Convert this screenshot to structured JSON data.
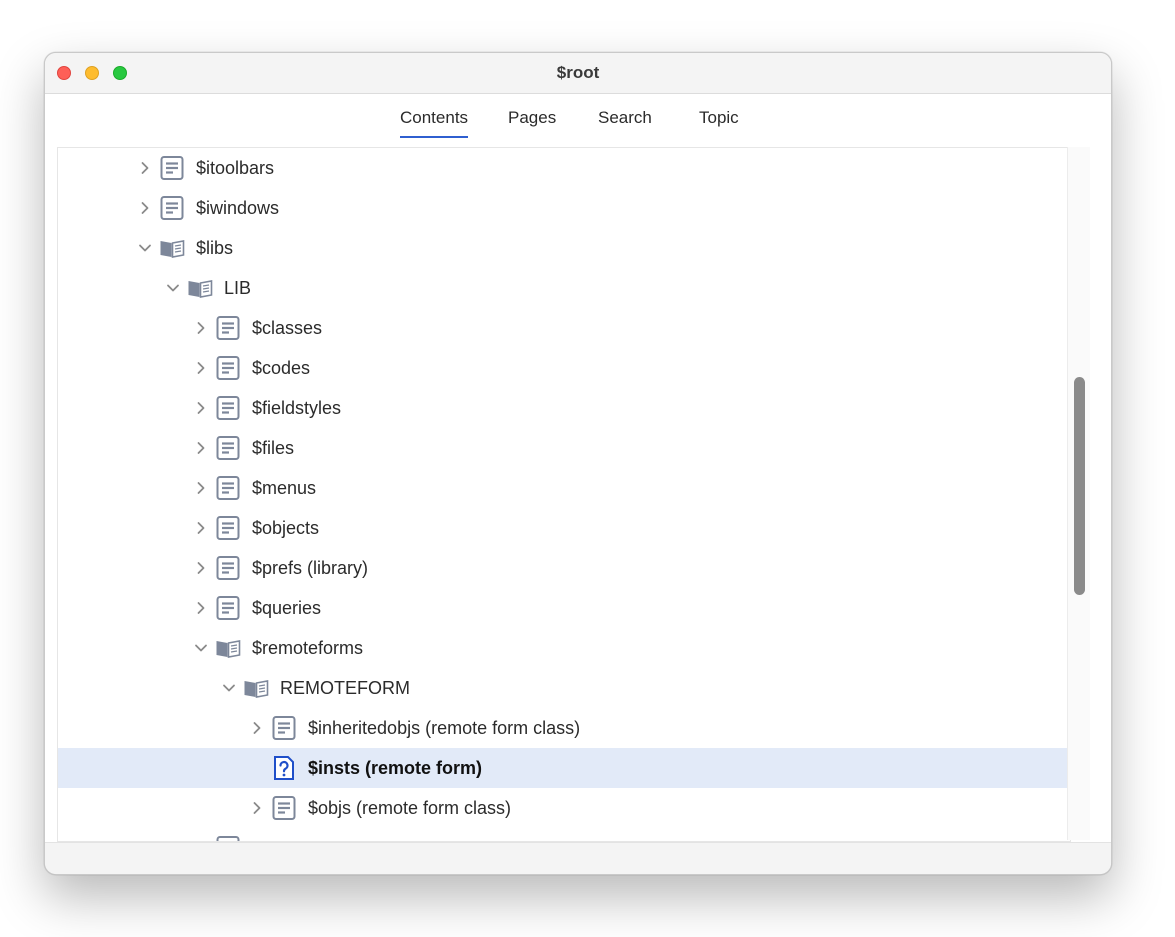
{
  "window": {
    "title": "$root"
  },
  "tabs": [
    {
      "label": "Contents",
      "active": true
    },
    {
      "label": "Pages",
      "active": false
    },
    {
      "label": "Search",
      "active": false
    },
    {
      "label": "Topic",
      "active": false
    }
  ],
  "tree": {
    "items": [
      {
        "label": "$itoolbars",
        "depth": 0,
        "chevron": "right",
        "icon": "page-icon"
      },
      {
        "label": "$iwindows",
        "depth": 0,
        "chevron": "right",
        "icon": "page-icon"
      },
      {
        "label": "$libs",
        "depth": 0,
        "chevron": "down",
        "icon": "book-icon"
      },
      {
        "label": "LIB",
        "depth": 1,
        "chevron": "down",
        "icon": "book-icon"
      },
      {
        "label": "$classes",
        "depth": 2,
        "chevron": "right",
        "icon": "page-icon"
      },
      {
        "label": "$codes",
        "depth": 2,
        "chevron": "right",
        "icon": "page-icon"
      },
      {
        "label": "$fieldstyles",
        "depth": 2,
        "chevron": "right",
        "icon": "page-icon"
      },
      {
        "label": "$files",
        "depth": 2,
        "chevron": "right",
        "icon": "page-icon"
      },
      {
        "label": "$menus",
        "depth": 2,
        "chevron": "right",
        "icon": "page-icon"
      },
      {
        "label": "$objects",
        "depth": 2,
        "chevron": "right",
        "icon": "page-icon"
      },
      {
        "label": "$prefs (library)",
        "depth": 2,
        "chevron": "right",
        "icon": "page-icon"
      },
      {
        "label": "$queries",
        "depth": 2,
        "chevron": "right",
        "icon": "page-icon"
      },
      {
        "label": "$remoteforms",
        "depth": 2,
        "chevron": "down",
        "icon": "book-icon"
      },
      {
        "label": "REMOTEFORM",
        "depth": 3,
        "chevron": "down",
        "icon": "book-icon"
      },
      {
        "label": "$inheritedobjs (remote form class)",
        "depth": 4,
        "chevron": "right",
        "icon": "page-icon"
      },
      {
        "label": "$insts (remote form)",
        "depth": 4,
        "chevron": "none",
        "icon": "help-page-icon",
        "selected": true
      },
      {
        "label": "$objs (remote form class)",
        "depth": 4,
        "chevron": "right",
        "icon": "page-icon"
      },
      {
        "label": "",
        "depth": 2,
        "chevron": "right",
        "icon": "page-icon"
      }
    ]
  },
  "colors": {
    "selection": "#e2eaf8",
    "accent": "#2f5fd0",
    "icon_gray": "#7d879a",
    "help_icon_blue": "#1f4fc9"
  }
}
